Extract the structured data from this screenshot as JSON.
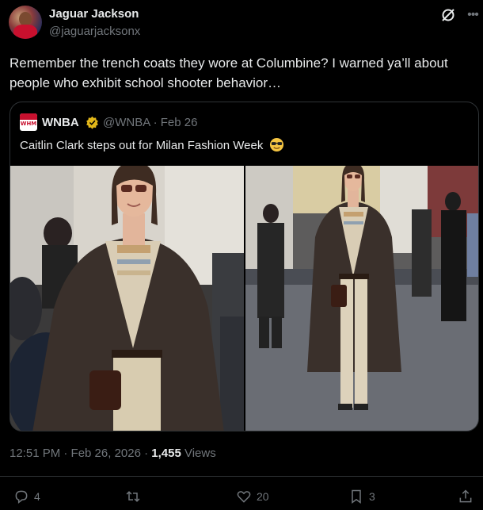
{
  "author": {
    "name": "Jaguar Jackson",
    "handle": "@jaguarjacksonx"
  },
  "tweet": {
    "text": "Remember the trench coats they wore at Columbine? I warned ya’ll about people who exhibit school shooter behavior…"
  },
  "quoted": {
    "name": "WNBA",
    "handle_date": "@WNBA · Feb 26",
    "avatar_text": "WHM",
    "text": "Caitlin Clark steps out for Milan Fashion Week",
    "emoji": "smiling-face-with-sunglasses",
    "photos": [
      {
        "name": "photo-left"
      },
      {
        "name": "photo-right"
      }
    ]
  },
  "meta": {
    "timestamp": "12:51 PM · Feb 26, 2026 · ",
    "views_count": "1,455",
    "views_label": " Views"
  },
  "actions": {
    "replies": "4",
    "retweets": "",
    "likes": "20",
    "bookmarks": "3"
  },
  "colors": {
    "background": "#000000",
    "text": "#e7e9ea",
    "muted": "#71767b",
    "border": "#2f3336",
    "verified": "#e2b719"
  }
}
